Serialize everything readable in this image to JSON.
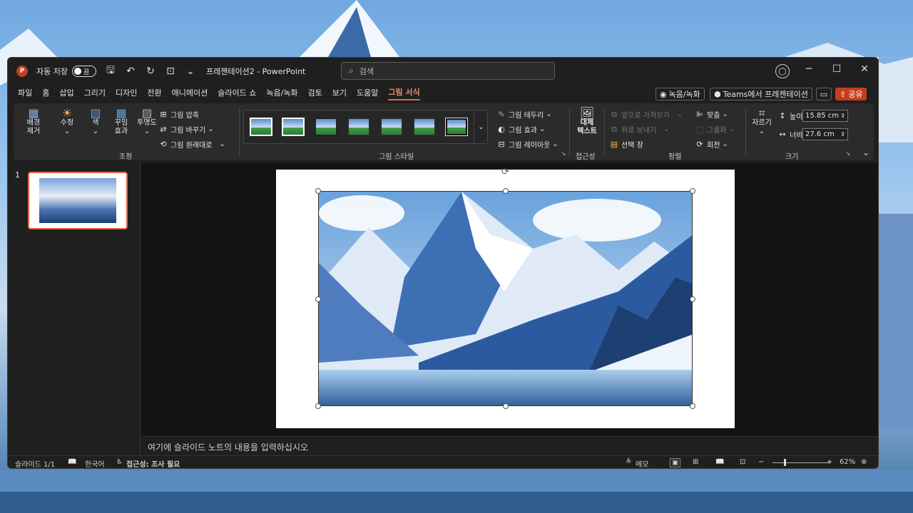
{
  "titlebar": {
    "autosave_label": "자동 저장",
    "autosave_state": "끔",
    "doc_title": "프레젠테이션2 - PowerPoint",
    "search_placeholder": "검색",
    "minimize": "─",
    "maximize": "☐",
    "close": "✕"
  },
  "tabs": [
    "파일",
    "홈",
    "삽입",
    "그리기",
    "디자인",
    "전환",
    "애니메이션",
    "슬라이드 쇼",
    "녹음/녹화",
    "검토",
    "보기",
    "도움말",
    "그림 서식"
  ],
  "tab_buttons": {
    "record": "녹음/녹화",
    "teams": "Teams에서 프레젠테이션",
    "share": "공유"
  },
  "ribbon": {
    "adjust": {
      "remove_bg": "배경\n제거",
      "corrections": "수정",
      "color": "색",
      "artistic": "꾸밈\n효과",
      "transparency": "투명도",
      "compress": "그림 압축",
      "change": "그림 바꾸기",
      "reset": "그림 원래대로",
      "label": "조정"
    },
    "styles": {
      "border": "그림 테두리",
      "effects": "그림 효과",
      "layout": "그림 레이아웃",
      "label": "그림 스타일"
    },
    "accessibility": {
      "alt_text": "대체\n텍스트",
      "label": "접근성"
    },
    "arrange": {
      "bring_forward": "앞으로 가져오기",
      "send_backward": "뒤로 보내기",
      "selection_pane": "선택 창",
      "align": "맞춤",
      "group": "그룹화",
      "rotate": "회전",
      "label": "정렬"
    },
    "size": {
      "crop": "자르기",
      "height_label": "높이:",
      "height_value": "15.85 cm",
      "width_label": "너비:",
      "width_value": "27.6 cm",
      "label": "크기"
    }
  },
  "slides_panel": {
    "slide_number": "1"
  },
  "notes": {
    "placeholder": "여기에 슬라이드 노트의 내용을 입력하십시오"
  },
  "statusbar": {
    "slide_info": "슬라이드 1/1",
    "language": "한국어",
    "accessibility": "접근성: 조사 필요",
    "notes_btn": "메모",
    "zoom_minus": "−",
    "zoom_plus": "+",
    "zoom_level": "62%"
  },
  "colors": {
    "accent": "#c43e1c",
    "active_tab": "#e0664a"
  }
}
